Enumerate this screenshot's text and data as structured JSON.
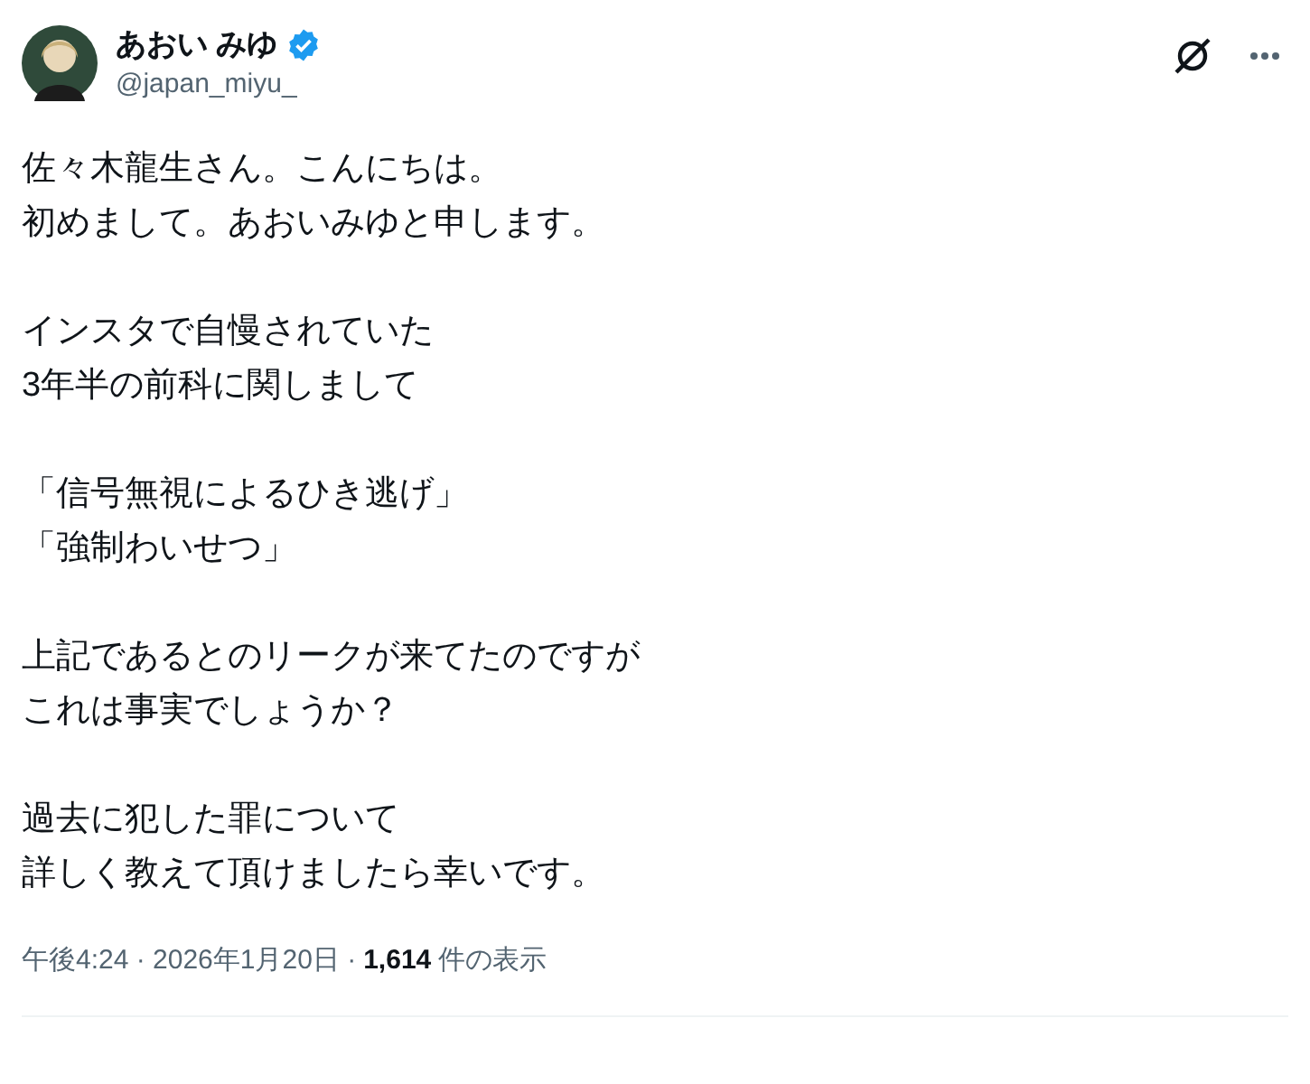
{
  "author": {
    "name": "あおい みゆ",
    "handle": "@japan_miyu_",
    "verified": true
  },
  "paragraphs": [
    [
      "佐々木龍生さん。こんにちは。",
      "初めまして。あおいみゆと申します。"
    ],
    [
      "インスタで自慢されていた",
      "3年半の前科に関しまして"
    ],
    [
      "「信号無視によるひき逃げ」",
      "「強制わいせつ」"
    ],
    [
      "上記であるとのリークが来てたのですが",
      "これは事実でしょうか？"
    ],
    [
      "過去に犯した罪について",
      "詳しく教えて頂けましたら幸いです。"
    ]
  ],
  "meta": {
    "timestamp": "午後4:24 · 2026年1月20日 ·",
    "views_count": "1,614",
    "views_label": "件の表示"
  }
}
